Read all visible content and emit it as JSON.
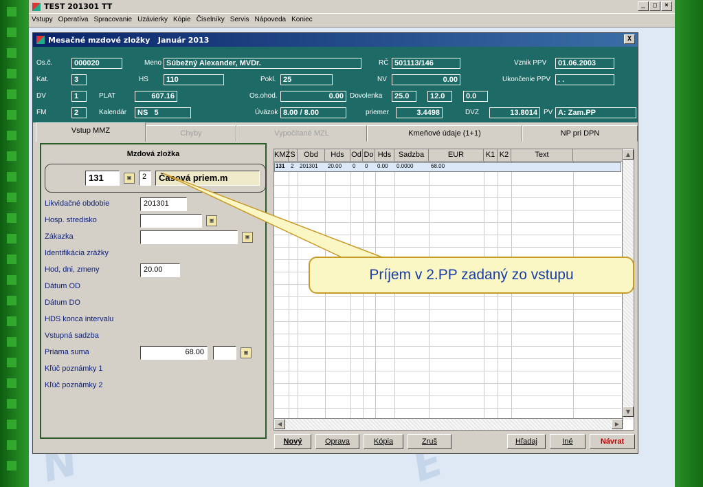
{
  "app": {
    "title": "TEST 201301 TT",
    "menu": [
      "Vstupy",
      "Operatíva",
      "Spracovanie",
      "Uzávierky",
      "Kópie",
      "Číselníky",
      "Servis",
      "Nápoveda",
      "Koniec"
    ]
  },
  "window": {
    "title": "Mesačné mzdové zložky",
    "period": "Január 2013",
    "close": "X"
  },
  "header": {
    "osc_label": "Os.č.",
    "osc_value": "000020",
    "meno_label": "Meno",
    "meno_value": "Súbežný Alexander, MVDr.",
    "rc_label": "RČ",
    "rc_value": "501113/146",
    "vznik_label": "Vznik PPV",
    "vznik_value": "01.06.2003",
    "kat_label": "Kat.",
    "kat_value": "3",
    "hs_label": "HS",
    "hs_value": "110",
    "pokl_label": "Pokl.",
    "pokl_value": "25",
    "nv_label": "NV",
    "nv_value": "0.00",
    "ukoncenie_label": "Ukončenie PPV",
    "ukoncenie_value": ". .",
    "dv_label": "DV",
    "dv_value": "1",
    "plat_label": "PLAT",
    "plat_value": "607.16",
    "osohod_label": "Os.ohod.",
    "osohod_value": "0.00",
    "dovolenka_label": "Dovolenka",
    "dovolenka_v1": "25.0",
    "dovolenka_v2": "12.0",
    "dovolenka_v3": "0.0",
    "fm_label": "FM",
    "fm_value": "2",
    "kalendar_label": "Kalendár",
    "kalendar_value": "NS   5",
    "uvazok_label": "Úväzok",
    "uvazok_value": "8.00 / 8.00",
    "priemer_label": "priemer",
    "priemer_value": "3.4498",
    "dvz_label": "DVZ",
    "dvz_value": "13.8014",
    "pv_label": "PV",
    "pv_value": "A: Zam.PP"
  },
  "tabs": [
    {
      "label": "Vstup MMZ",
      "active": true
    },
    {
      "label": "Chyby",
      "active": false
    },
    {
      "label": "Vypočítané MZL",
      "active": false
    },
    {
      "label": "Kmeňové údaje (1+1)",
      "active": false
    },
    {
      "label": "NP pri DPN",
      "active": false
    }
  ],
  "form": {
    "title": "Mzdová zložka",
    "code": "131",
    "code_s": "2",
    "code_name": "Časová priem.m",
    "fields": [
      {
        "label": "Likvidačné obdobie",
        "value": "201301"
      },
      {
        "label": "Hosp. stredisko",
        "value": ""
      },
      {
        "label": "Zákazka",
        "value": ""
      },
      {
        "label": "Identifikácia zrážky",
        "value": ""
      },
      {
        "label": "Hod, dni, zmeny",
        "value": "20.00"
      },
      {
        "label": "Dátum OD",
        "value": ""
      },
      {
        "label": "Dátum DO",
        "value": ""
      },
      {
        "label": "HDS konca intervalu",
        "value": ""
      },
      {
        "label": "Vstupná sadzba",
        "value": ""
      },
      {
        "label": "Priama suma",
        "value": "68.00"
      },
      {
        "label": "Kľúč poznámky 1",
        "value": ""
      },
      {
        "label": "Kľúč poznámky 2",
        "value": ""
      }
    ]
  },
  "grid": {
    "columns": [
      "KMZ",
      "S",
      "Obd",
      "Hds",
      "Od",
      "Do",
      "Hds",
      "Sadzba",
      "EUR",
      "K1",
      "K2",
      "Text"
    ],
    "rows": [
      [
        "131",
        "2",
        "201301",
        "20.00",
        "0",
        "0",
        "0.00",
        "0.0000",
        "68.00",
        "",
        "",
        ""
      ]
    ]
  },
  "buttons": {
    "novy": "Nový",
    "oprava": "Oprava",
    "kopia": "Kópia",
    "zrus": "Zruš",
    "hladaj": "Hľadaj",
    "ine": "Iné",
    "navrat": "Návrat"
  },
  "callout": "Príjem v 2.PP zadaný zo vstupu"
}
